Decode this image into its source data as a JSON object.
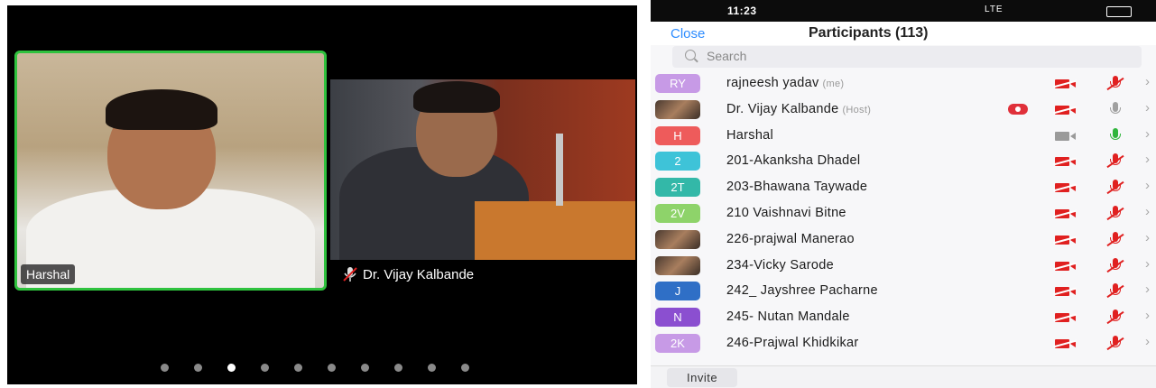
{
  "meeting": {
    "tiles": [
      {
        "name": "Harshal",
        "active_speaker": true
      },
      {
        "name": "Dr. Vijay Kalbande",
        "muted": true
      }
    ],
    "page_dots": {
      "count": 10,
      "active_index": 2
    }
  },
  "panel": {
    "status": {
      "time": "11:23",
      "network": "LTE"
    },
    "close_label": "Close",
    "title": "Participants (113)",
    "search_placeholder": "Search",
    "invite_label": "Invite",
    "participants": [
      {
        "initials": "RY",
        "color": "#c79ae6",
        "name": "rajneesh yadav",
        "tag": "(me)",
        "video": "off",
        "mic": "muted"
      },
      {
        "initials": "",
        "photo": true,
        "name": "Dr. Vijay Kalbande",
        "tag": "(Host)",
        "recording": true,
        "video": "off",
        "mic": "off-gray"
      },
      {
        "initials": "H",
        "color": "#ee5b5b",
        "name": "Harshal",
        "tag": "",
        "video": "on-gray",
        "mic": "on-green"
      },
      {
        "initials": "2",
        "color": "#3ec3d8",
        "name": "201-Akanksha  Dhadel",
        "tag": "",
        "video": "off",
        "mic": "muted"
      },
      {
        "initials": "2T",
        "color": "#33b8a8",
        "name": "203-Bhawana Taywade",
        "tag": "",
        "video": "off",
        "mic": "muted"
      },
      {
        "initials": "2V",
        "color": "#8ed36a",
        "name": "210 Vaishnavi Bitne",
        "tag": "",
        "video": "off",
        "mic": "muted"
      },
      {
        "initials": "",
        "photo": true,
        "name": "226-prajwal Manerao",
        "tag": "",
        "video": "off",
        "mic": "muted"
      },
      {
        "initials": "",
        "photo": true,
        "name": "234-Vicky Sarode",
        "tag": "",
        "video": "off",
        "mic": "muted"
      },
      {
        "initials": "J",
        "color": "#2f6fc6",
        "name": "242_ Jayshree Pacharne",
        "tag": "",
        "video": "off",
        "mic": "muted"
      },
      {
        "initials": "N",
        "color": "#8b4fd0",
        "name": "245- Nutan Mandale",
        "tag": "",
        "video": "off",
        "mic": "muted"
      },
      {
        "initials": "2K",
        "color": "#c79ae6",
        "name": "246-Prajwal Khidkikar",
        "tag": "",
        "video": "off",
        "mic": "muted"
      }
    ]
  }
}
